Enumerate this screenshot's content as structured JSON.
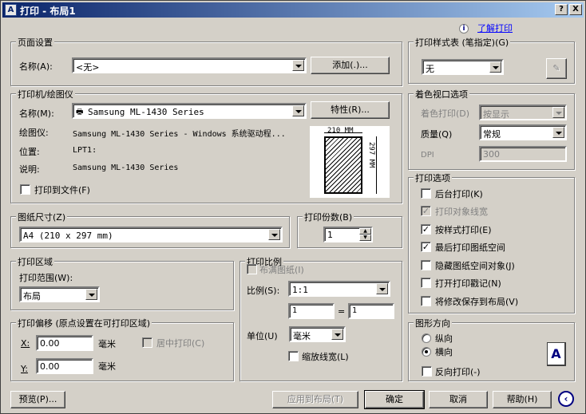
{
  "window": {
    "title": "打印 - 布局1",
    "app_icon": "autocad-a-icon",
    "help_btn": "?",
    "close_btn": "X"
  },
  "help_link": {
    "icon": "i",
    "label": "了解打印"
  },
  "page_setup": {
    "title": "页面设置",
    "name_label": "名称(A):",
    "name_value": "<无>",
    "add_button": "添加(.)..."
  },
  "printer": {
    "title": "打印机/绘图仪",
    "name_label": "名称(M):",
    "name_value": "Samsung ML-1430 Series",
    "properties_button": "特性(R)...",
    "plotter_label": "绘图仪:",
    "plotter_value": "Samsung ML-1430 Series - Windows 系统驱动程...",
    "location_label": "位置:",
    "location_value": "LPT1:",
    "description_label": "说明:",
    "description_value": "Samsung ML-1430 Series",
    "print_to_file": "打印到文件(F)",
    "preview": {
      "width_label": "210 MM",
      "height_label": "297 MM"
    }
  },
  "paper_size": {
    "title": "图纸尺寸(Z)",
    "value": "A4 (210 x 297 mm)"
  },
  "copies": {
    "title": "打印份数(B)",
    "value": "1"
  },
  "plot_area": {
    "title": "打印区域",
    "range_label": "打印范围(W):",
    "range_value": "布局"
  },
  "plot_scale": {
    "title": "打印比例",
    "fit_paper": "布满图纸(I)",
    "scale_label": "比例(S):",
    "scale_value": "1:1",
    "scale_num": "1",
    "equals": "=",
    "scale_den": "1",
    "units_label": "单位(U)",
    "units_value": "毫米",
    "scale_lineweights": "缩放线宽(L)"
  },
  "plot_offset": {
    "title": "打印偏移 (原点设置在可打印区域)",
    "x_label": "X:",
    "x_value": "0.00",
    "x_unit": "毫米",
    "center_plot": "居中打印(C)",
    "y_label": "Y:",
    "y_value": "0.00",
    "y_unit": "毫米"
  },
  "plot_style_table": {
    "title": "打印样式表 (笔指定)(G)",
    "value": "无"
  },
  "shaded_viewport": {
    "title": "着色视口选项",
    "shade_plot_label": "着色打印(D)",
    "shade_plot_value": "按显示",
    "quality_label": "质量(Q)",
    "quality_value": "常规",
    "dpi_label": "DPI",
    "dpi_value": "300"
  },
  "plot_options": {
    "title": "打印选项",
    "items": [
      {
        "label": "后台打印(K)",
        "checked": false,
        "disabled": false
      },
      {
        "label": "打印对象线宽",
        "checked": true,
        "disabled": true
      },
      {
        "label": "按样式打印(E)",
        "checked": true,
        "disabled": false
      },
      {
        "label": "最后打印图纸空间",
        "checked": true,
        "disabled": false
      },
      {
        "label": "隐藏图纸空间对象(J)",
        "checked": false,
        "disabled": false
      },
      {
        "label": "打开打印戳记(N)",
        "checked": false,
        "disabled": false
      },
      {
        "label": "将修改保存到布局(V)",
        "checked": false,
        "disabled": false
      }
    ]
  },
  "orientation": {
    "title": "图形方向",
    "portrait": "纵向",
    "landscape": "横向",
    "upside_down": "反向打印(-)",
    "icon_letter": "A"
  },
  "footer": {
    "preview": "预览(P)...",
    "apply_layout": "应用到布局(T)",
    "ok": "确定",
    "cancel": "取消",
    "help": "帮助(H)"
  }
}
